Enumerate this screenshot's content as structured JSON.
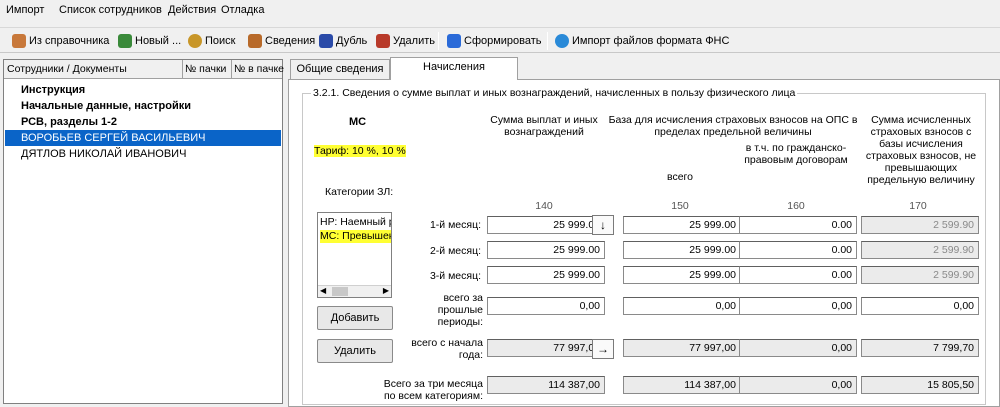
{
  "menu": [
    "Импорт",
    "Список сотрудников",
    "Действия",
    "Отладка"
  ],
  "toolbar": {
    "from_ref": "Из справочника",
    "new": "Новый ...",
    "search": "Поиск",
    "info": "Сведения",
    "dup": "Дубль",
    "delete": "Удалить",
    "form": "Сформировать",
    "import_fns": "Импорт файлов формата ФНС"
  },
  "tree": {
    "headers": [
      "Сотрудники / Документы",
      "№ пачки",
      "№ в пачке"
    ],
    "rows": [
      "Инструкция",
      "Начальные данные, настройки",
      "РСВ, разделы 1-2",
      "ВОРОБЬЕВ СЕРГЕЙ ВАСИЛЬЕВИЧ",
      "ДЯТЛОВ НИКОЛАЙ ИВАНОВИЧ"
    ]
  },
  "tabs": [
    "Общие сведения",
    "Начисления"
  ],
  "section": {
    "title": "3.2.1. Сведения о сумме выплат и иных вознаграждений, начисленных в пользу физического лица",
    "category_code": "МС",
    "tariff": "Тариф: 10 %, 10 %",
    "categories_label": "Категории ЗЛ:",
    "categories": [
      "НР: Наемный раб",
      "МС: Превышение"
    ],
    "add_button": "Добавить",
    "delete_button": "Удалить",
    "col_headers": {
      "sum": "Сумма выплат и иных вознаграждений",
      "base": "База для исчисления страховых взносов на ОПС в пределах предельной величины",
      "base_total": "всего",
      "base_gpd": "в т.ч. по гражданско-правовым договорам",
      "insurance": "Сумма исчисленных страховых взносов с базы исчисления страховых взносов, не превышающих предельную величину"
    },
    "col_numbers": [
      "140",
      "150",
      "160",
      "170"
    ],
    "row_labels": {
      "m1": "1-й месяц:",
      "m2": "2-й месяц:",
      "m3": "3-й месяц:",
      "prev": "всего за прошлые периоды:",
      "ytd": "всего с начала года:",
      "all": "Всего за три месяца по всем категориям:"
    },
    "rows": {
      "m1": [
        "25 999.00",
        "25 999.00",
        "0.00",
        "2 599.90"
      ],
      "m2": [
        "25 999.00",
        "25 999.00",
        "0.00",
        "2 599.90"
      ],
      "m3": [
        "25 999.00",
        "25 999.00",
        "0.00",
        "2 599.90"
      ],
      "prev": [
        "0,00",
        "0,00",
        "0,00",
        "0,00"
      ],
      "ytd": [
        "77 997,00",
        "77 997,00",
        "0,00",
        "7 799,70"
      ],
      "all": [
        "114 387,00",
        "114 387,00",
        "0,00",
        "15 805,50"
      ]
    }
  }
}
